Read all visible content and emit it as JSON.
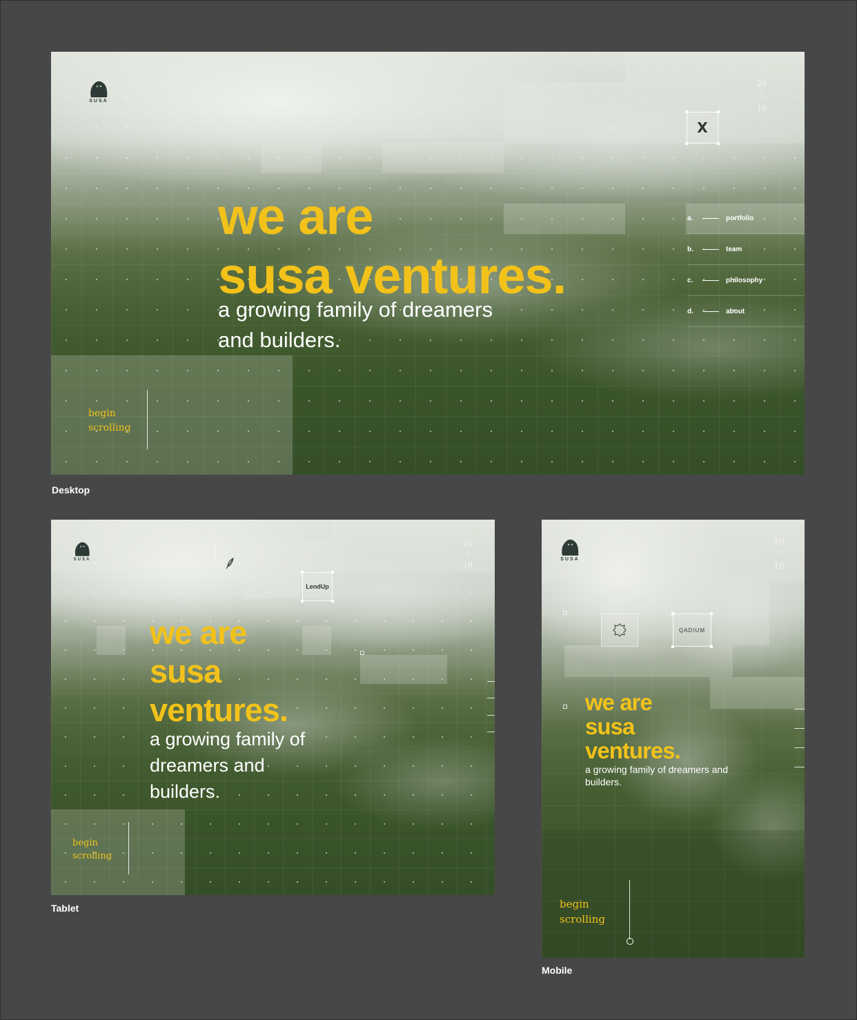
{
  "brand": {
    "name": "SUSA",
    "headline_line1": "we are",
    "headline_line2": "susa ventures.",
    "tablet_line2": "susa",
    "tablet_line3": "ventures.",
    "tagline_desktop_1": "a growing family of dreamers",
    "tagline_desktop_2": "and builders.",
    "tagline_tablet_1": "a growing family of",
    "tagline_tablet_2": "dreamers and",
    "tagline_tablet_3": "builders.",
    "tagline_mobile_1": "a growing family of dreamers and",
    "tagline_mobile_2": "builders.",
    "accent_color": "#f2c21b"
  },
  "counter": {
    "top": "20",
    "sep": "/",
    "bottom": "16"
  },
  "scroll": {
    "line1": "begin",
    "line2": "scrolling"
  },
  "nav": [
    {
      "letter": "a.",
      "label": "portfolio"
    },
    {
      "letter": "b.",
      "label": "team"
    },
    {
      "letter": "c.",
      "label": "philosophy"
    },
    {
      "letter": "d.",
      "label": "about"
    }
  ],
  "portfolio_logos": {
    "desktop": "X",
    "tablet": "LendUp",
    "mobile": "QADIUM"
  },
  "captions": {
    "desktop": "Desktop",
    "tablet": "Tablet",
    "mobile": "Mobile"
  }
}
